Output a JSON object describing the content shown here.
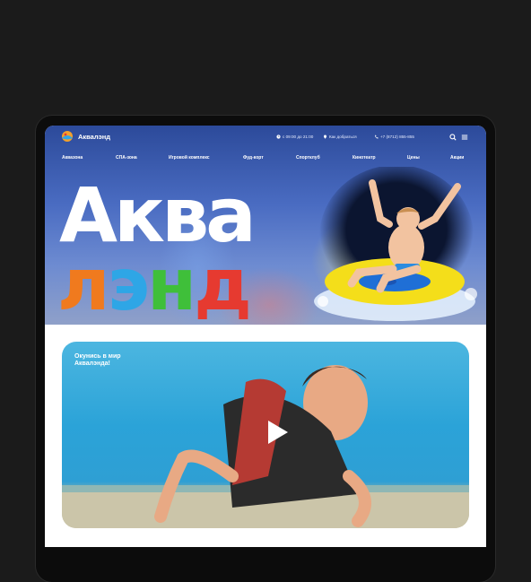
{
  "header": {
    "brand": "Аквалэнд",
    "hours": "с 09:00 до 21:00",
    "directions": "Как добраться",
    "phone": "+7 (8712) 855-855"
  },
  "nav": {
    "items": [
      "Аквазона",
      "СПА-зона",
      "Игровой комплекс",
      "Фуд-корт",
      "Спортклуб",
      "Кинотеатр",
      "Цены",
      "Акции"
    ]
  },
  "hero": {
    "title_line1": "Аква",
    "title_line2_letters": [
      "л",
      "э",
      "н",
      "д"
    ],
    "title_line2_colors": [
      "#f07a1e",
      "#2ea6e6",
      "#3fbf3a",
      "#e63a30"
    ]
  },
  "video": {
    "caption": "Окунись в мир Аквалэнда!"
  },
  "colors": {
    "background": "#1b1b1b",
    "hero_blue": "#4a6cc2",
    "pool_blue": "#2ba3d8"
  }
}
